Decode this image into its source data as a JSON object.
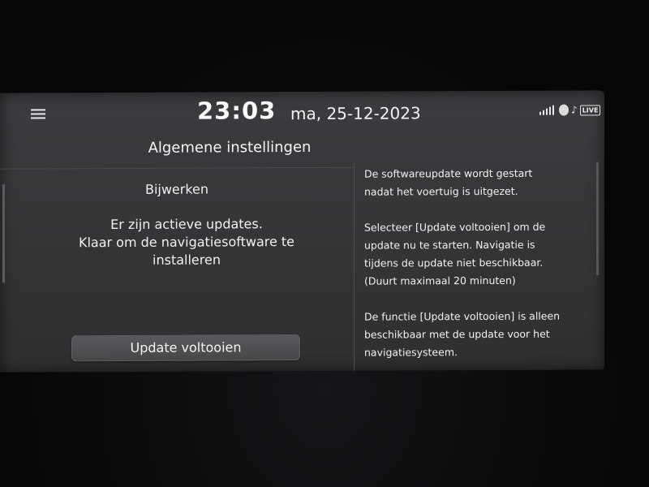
{
  "status": {
    "time": "23:03",
    "date": "ma, 25-12-2023",
    "live_label": "LIVE",
    "icons": [
      "menu-icon",
      "signal-icon",
      "bluetooth-icon",
      "music-note-icon",
      "live-badge"
    ]
  },
  "page": {
    "title": "Algemene instellingen"
  },
  "update": {
    "section_title": "Bijwerken",
    "message_lines": [
      "Er zijn actieve updates.",
      "Klaar om de navigatiesoftware te",
      "installeren"
    ],
    "button_label": "Update voltooien"
  },
  "info": {
    "paragraphs": [
      [
        "De softwareupdate wordt gestart",
        "nadat het voertuig is uitgezet."
      ],
      [
        "Selecteer [Update voltooien] om de",
        "update nu te starten. Navigatie is",
        "tijdens de update niet beschikbaar.",
        "(Duurt maximaal 20 minuten)"
      ],
      [
        "De functie [Update voltooien] is alleen",
        "beschikbaar met de update voor het",
        "navigatiesysteem."
      ]
    ]
  },
  "colors": {
    "screen_bg": "#37383b",
    "text": "#f4f4f4",
    "button_bg": "#505154"
  }
}
